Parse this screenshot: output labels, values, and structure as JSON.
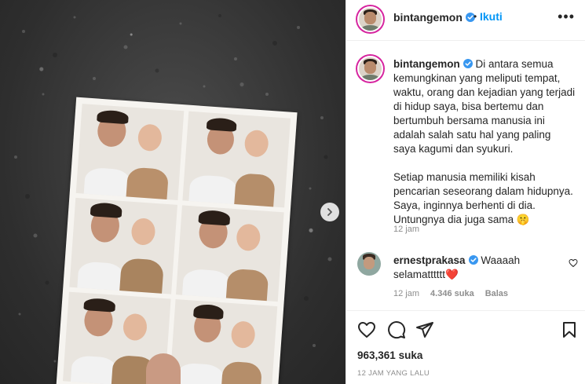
{
  "post": {
    "media_alt": "Photo booth strip on granite surface",
    "next_icon": "chevron-right-icon"
  },
  "header": {
    "username": "bintangemon",
    "separator": "•",
    "follow_label": "Ikuti",
    "more_label": "•••"
  },
  "caption": {
    "username": "bintangemon",
    "paragraph1": "Di antara semua kemungkinan yang meliputi tempat, waktu, orang dan kejadian yang terjadi di hidup saya, bisa bertemu dan bertumbuh bersama manusia ini adalah salah satu hal yang paling saya kagumi dan syukuri.",
    "paragraph2": "Setiap manusia memiliki kisah pencarian seseorang dalam hidupnya. Saya, inginnya berhenti di dia. Untungnya dia juga sama 🤫",
    "time": "12 jam"
  },
  "comment": {
    "username": "ernestprakasa",
    "text": "Waaaah selamatttttt❤️",
    "time": "12 jam",
    "likes": "4.346 suka",
    "reply_label": "Balas"
  },
  "stats": {
    "likes_count": "963,361",
    "likes_word": "suka",
    "posted": "12 JAM YANG LALU"
  },
  "colors": {
    "accent": "#0095f6",
    "verified": "#3897f0",
    "heart": "#ed4956",
    "muted": "#8e8e8e",
    "text": "#262626"
  }
}
